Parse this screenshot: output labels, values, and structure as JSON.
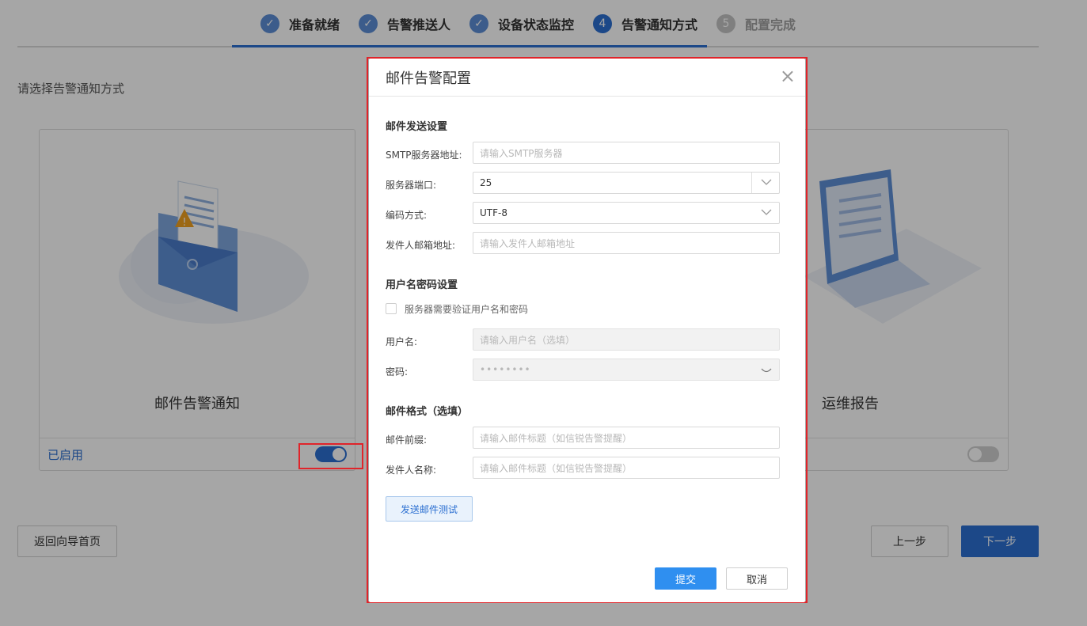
{
  "steps": [
    {
      "label": "准备就绪",
      "state": "done",
      "marker": "✓"
    },
    {
      "label": "告警推送人",
      "state": "done",
      "marker": "✓"
    },
    {
      "label": "设备状态监控",
      "state": "done",
      "marker": "✓"
    },
    {
      "label": "告警通知方式",
      "state": "active",
      "marker": "4"
    },
    {
      "label": "配置完成",
      "state": "todo",
      "marker": "5"
    }
  ],
  "page": {
    "prompt": "请选择告警通知方式"
  },
  "cards": {
    "email": {
      "title": "邮件告警通知",
      "status": "已启用",
      "enabled": true,
      "icon": "mail-alert-illustration"
    },
    "report": {
      "title": "运维报告",
      "enabled": false,
      "icon": "laptop-illustration"
    }
  },
  "footer": {
    "back_home": "返回向导首页",
    "prev": "上一步",
    "next": "下一步"
  },
  "modal": {
    "title": "邮件告警配置",
    "close_icon": "×",
    "send_section": "邮件发送设置",
    "smtp_label": "SMTP服务器地址:",
    "smtp_placeholder": "请输入SMTP服务器",
    "port_label": "服务器端口:",
    "port_value": "25",
    "encoding_label": "编码方式:",
    "encoding_value": "UTF-8",
    "sender_label": "发件人邮箱地址:",
    "sender_placeholder": "请输入发件人邮箱地址",
    "auth_section": "用户名密码设置",
    "auth_checkbox_label": "服务器需要验证用户名和密码",
    "auth_checked": false,
    "username_label": "用户名:",
    "username_placeholder": "请输入用户名（选填）",
    "password_label": "密码:",
    "password_value": "••••••••",
    "format_section": "邮件格式（选填）",
    "prefix_label": "邮件前缀:",
    "prefix_placeholder": "请输入邮件标题（如信锐告警提醒）",
    "sender_name_label": "发件人名称:",
    "sender_name_placeholder": "请输入邮件标题（如信锐告警提醒）",
    "test_button": "发送邮件测试",
    "submit": "提交",
    "cancel": "取消"
  },
  "colors": {
    "primary": "#2b6fd1",
    "highlight": "#e0242a"
  }
}
